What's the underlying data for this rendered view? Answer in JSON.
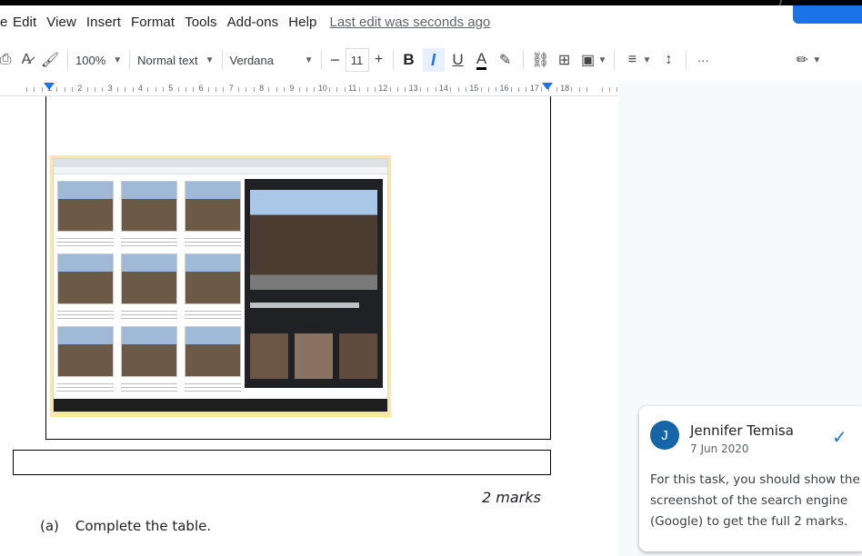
{
  "menubar": {
    "cut_label": "e",
    "items": [
      "Edit",
      "View",
      "Insert",
      "Format",
      "Tools",
      "Add-ons",
      "Help"
    ],
    "last_edit": "Last edit was seconds ago"
  },
  "toolbar": {
    "zoom": "100%",
    "style": "Normal text",
    "font": "Verdana",
    "minus": "−",
    "size": "11",
    "plus": "+",
    "bold": "B",
    "italic": "I",
    "underline": "U",
    "text_color": "A",
    "more": "···"
  },
  "ruler": {
    "numbers": [
      "1",
      "2",
      "3",
      "4",
      "5",
      "6",
      "7",
      "8",
      "9",
      "10",
      "11",
      "12",
      "13",
      "14",
      "15",
      "16",
      "17",
      "18"
    ]
  },
  "document": {
    "marks": "2 marks",
    "question_label": "(a)",
    "question_text": "Complete the table."
  },
  "comment": {
    "avatar_initial": "J",
    "author": "Jennifer Temisa",
    "date": "7 Jun 2020",
    "text": "For this task, you should show the screenshot of the search engine (Google) to get the full 2 marks."
  },
  "colors": {
    "accent": "#1a73e8",
    "avatar": "#1565a8",
    "screenshot_border": "#ffe7a0"
  }
}
